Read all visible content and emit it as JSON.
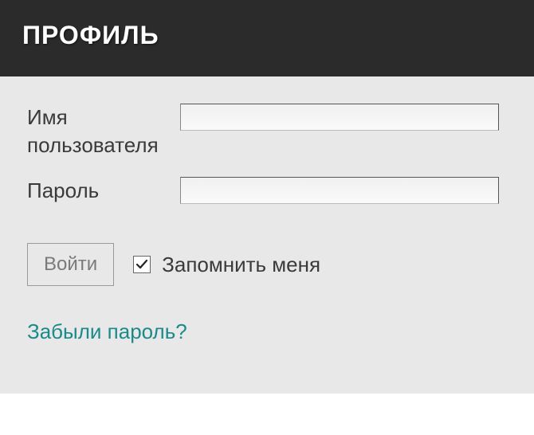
{
  "header": {
    "title": "ПРОФИЛЬ"
  },
  "form": {
    "username_label": "Имя пользователя",
    "username_value": "",
    "password_label": "Пароль",
    "password_value": "",
    "login_button": "Войти",
    "remember_label": "Запомнить меня",
    "remember_checked": true,
    "forgot_link": "Забыли пароль?"
  }
}
